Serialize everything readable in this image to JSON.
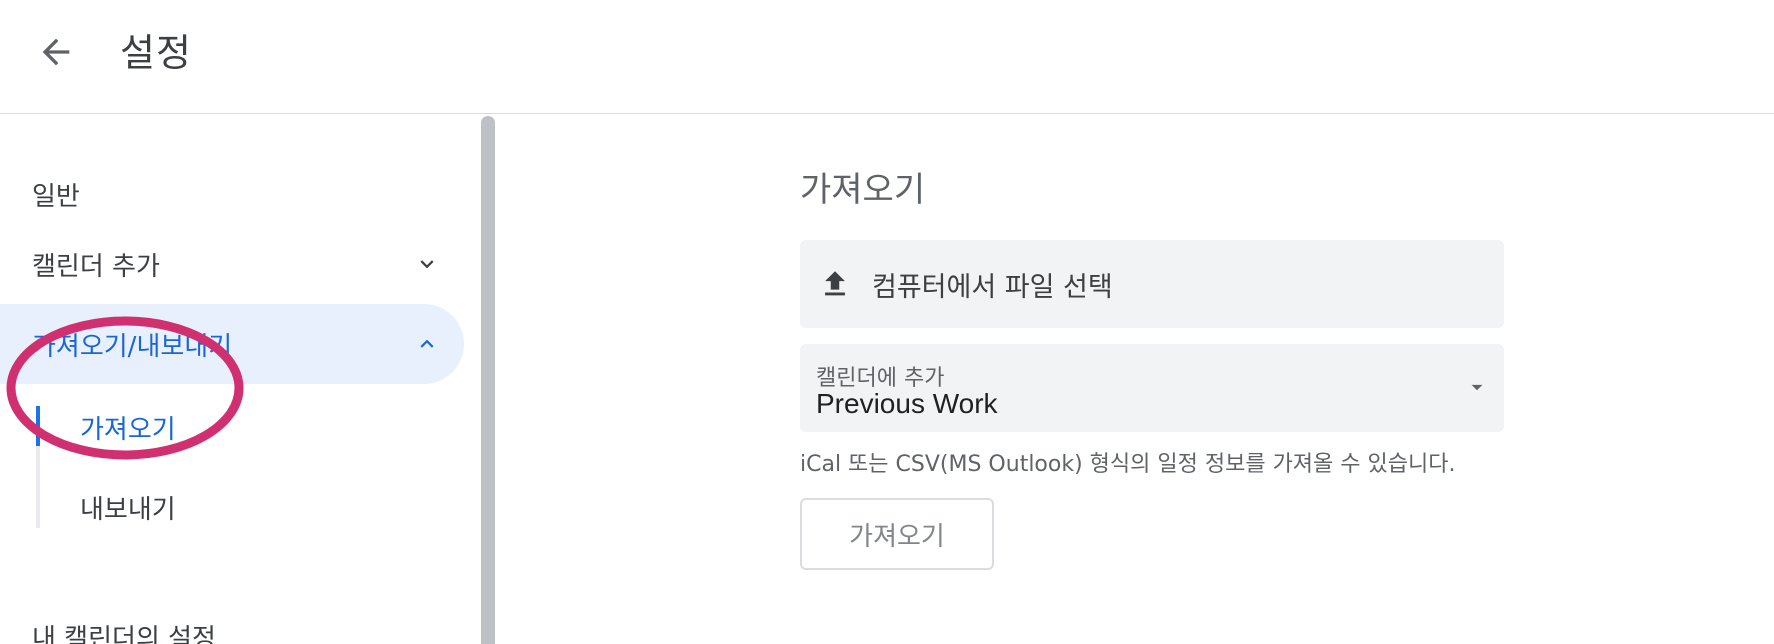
{
  "header": {
    "title": "설정",
    "back_icon": "arrow-back-icon"
  },
  "sidebar": {
    "items": [
      {
        "label": "일반"
      },
      {
        "label": "캘린더 추가",
        "chevron": "chevron-down-icon"
      },
      {
        "label": "가져오기/내보내기",
        "chevron": "chevron-up-icon",
        "active": true
      },
      {
        "label": "내 캘린더의 설정"
      }
    ],
    "subitems": [
      {
        "label": "가져오기",
        "active": true
      },
      {
        "label": "내보내기"
      }
    ]
  },
  "main": {
    "section_title": "가져오기",
    "file_picker": {
      "label": "컴퓨터에서 파일 선택",
      "icon": "upload-icon"
    },
    "calendar_select": {
      "label": "캘린더에 추가",
      "value": "Previous Work",
      "icon": "dropdown-arrow-icon"
    },
    "help_text": "iCal 또는 CSV(MS Outlook) 형식의 일정 정보를 가져올 수 있습니다.",
    "import_button": "가져오기"
  },
  "colors": {
    "accent": "#1a73e8",
    "active_bg": "#e8f0fe",
    "annotation": "#d0306f"
  }
}
